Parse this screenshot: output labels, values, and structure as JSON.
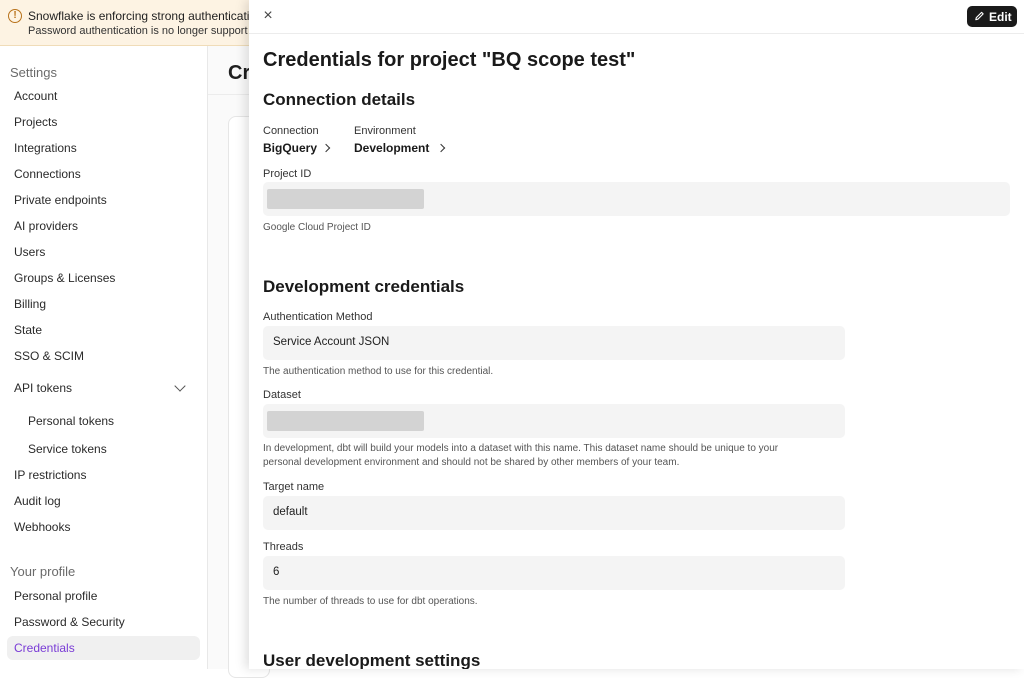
{
  "banner": {
    "line1": "Snowflake is enforcing strong authenticati",
    "line2": "Password authentication is no longer support"
  },
  "sidebar": {
    "settings_heading": "Settings",
    "items": [
      {
        "label": "Account"
      },
      {
        "label": "Projects"
      },
      {
        "label": "Integrations"
      },
      {
        "label": "Connections"
      },
      {
        "label": "Private endpoints"
      },
      {
        "label": "AI providers"
      },
      {
        "label": "Users"
      },
      {
        "label": "Groups & Licenses"
      },
      {
        "label": "Billing"
      },
      {
        "label": "State"
      },
      {
        "label": "SSO & SCIM"
      },
      {
        "label": "API tokens"
      },
      {
        "label": "Personal tokens"
      },
      {
        "label": "Service tokens"
      },
      {
        "label": "IP restrictions"
      },
      {
        "label": "Audit log"
      },
      {
        "label": "Webhooks"
      }
    ],
    "profile_heading": "Your profile",
    "profile_items": [
      {
        "label": "Personal profile"
      },
      {
        "label": "Password & Security"
      },
      {
        "label": "Credentials"
      }
    ]
  },
  "background": {
    "title_fragment": "Cr"
  },
  "panel": {
    "edit_label": "Edit",
    "title": "Credentials for project \"BQ scope test\"",
    "connection_details": {
      "heading": "Connection details",
      "connection_label": "Connection",
      "connection_value": "BigQuery",
      "environment_label": "Environment",
      "environment_value": "Development",
      "project_id_label": "Project ID",
      "project_id_help": "Google Cloud Project ID"
    },
    "dev_credentials": {
      "heading": "Development credentials",
      "auth_label": "Authentication Method",
      "auth_value": "Service Account JSON",
      "auth_help": "The authentication method to use for this credential.",
      "dataset_label": "Dataset",
      "dataset_help_1": "In development, dbt will build your models into a dataset with this name. This dataset name should be unique to your",
      "dataset_help_2": "personal development environment and should not be shared by other members of your team.",
      "target_label": "Target name",
      "target_value": "default",
      "threads_label": "Threads",
      "threads_value": "6",
      "threads_help": "The number of threads to use for dbt operations."
    },
    "user_dev_settings": {
      "heading": "User development settings"
    }
  },
  "colors": {
    "accent": "#7a3cd6",
    "banner_bg": "#fdf3e3",
    "warning": "#b8721b"
  }
}
